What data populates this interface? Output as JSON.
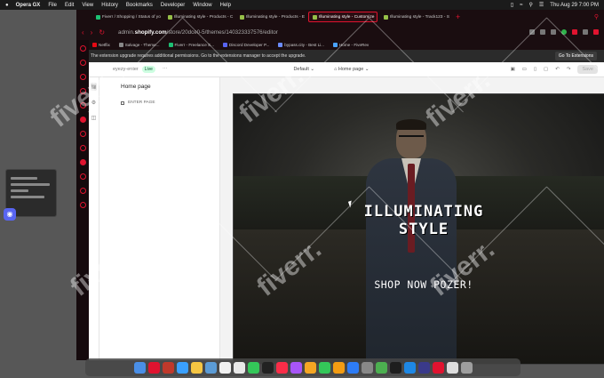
{
  "menubar": {
    "app_name": "Opera GX",
    "items": [
      "File",
      "Edit",
      "View",
      "History",
      "Bookmarks",
      "Developer",
      "Window",
      "Help"
    ],
    "clock": "Thu Aug 29  7:00 PM"
  },
  "browser": {
    "tabs": [
      {
        "label": "Fiverr / Shopping / Status of yo"
      },
      {
        "label": "Illuminating style - Products - C"
      },
      {
        "label": "Illuminating style - Products - E"
      },
      {
        "label": "Illuminating style - Customize"
      },
      {
        "label": "Illuminating style - Track123 - S"
      }
    ],
    "url_prefix": "admin.",
    "url_domain": "shopify.com",
    "url_path": "/store/20dce0-5/themes/140323337576/editor",
    "bookmarks": [
      {
        "label": "Netflix"
      },
      {
        "label": "Salvage - Theme..."
      },
      {
        "label": "Fiverr - Freelance S..."
      },
      {
        "label": "Discord Developer P..."
      },
      {
        "label": "bypass.city - Best Li..."
      },
      {
        "label": "Home - FiveRev"
      }
    ],
    "notice_text": "The extension upgrade requires additional permissions. Go to the extensions manager to accept the upgrade.",
    "notice_button": "Go To Extensions"
  },
  "editor": {
    "store_name": "eyezy-enter",
    "live_label": "Live",
    "theme_label": "Default",
    "page_label": "Home page",
    "save_label": "Save",
    "panel_title": "Home page",
    "panel_section": "ENTER PAGE",
    "hero_title_line1": "ILLUMINATING",
    "hero_title_line2": "STYLE",
    "hero_cta": "SHOP NOW POZER!"
  },
  "watermark": {
    "text": "fiverr."
  }
}
